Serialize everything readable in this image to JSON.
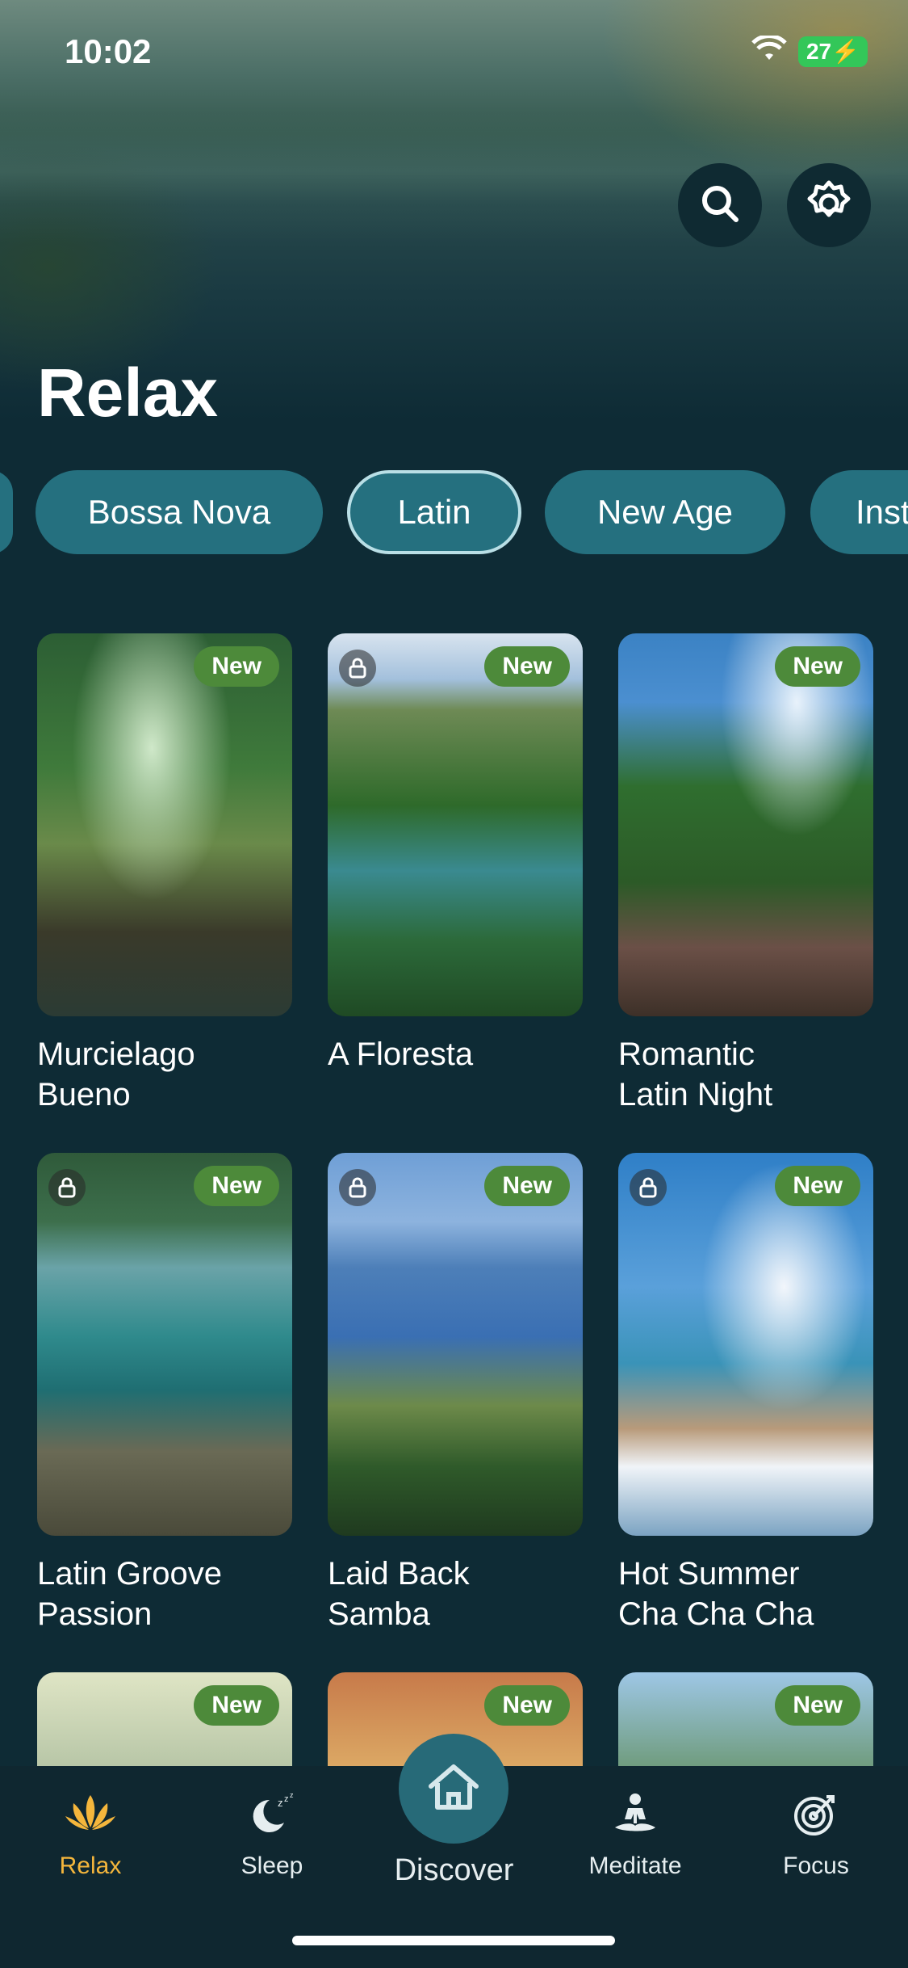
{
  "status": {
    "time": "10:02",
    "battery": "27"
  },
  "header": {
    "title": "Relax"
  },
  "categories": [
    {
      "label": "",
      "selected": false
    },
    {
      "label": "Bossa Nova",
      "selected": false
    },
    {
      "label": "Latin",
      "selected": true
    },
    {
      "label": "New Age",
      "selected": false
    },
    {
      "label": "Inst",
      "selected": false
    }
  ],
  "tracks": [
    {
      "title": "Murcielago\nBueno",
      "badge": "New",
      "locked": false
    },
    {
      "title": "A Floresta",
      "badge": "New",
      "locked": true
    },
    {
      "title": "Romantic\nLatin Night",
      "badge": "New",
      "locked": false
    },
    {
      "title": "Latin Groove\nPassion",
      "badge": "New",
      "locked": true
    },
    {
      "title": "Laid Back\nSamba",
      "badge": "New",
      "locked": true
    },
    {
      "title": "Hot Summer\nCha Cha Cha",
      "badge": "New",
      "locked": true
    },
    {
      "title": "",
      "badge": "New",
      "locked": false
    },
    {
      "title": "",
      "badge": "New",
      "locked": false
    },
    {
      "title": "",
      "badge": "New",
      "locked": false
    }
  ],
  "nav": {
    "relax": "Relax",
    "sleep": "Sleep",
    "discover": "Discover",
    "meditate": "Meditate",
    "focus": "Focus",
    "active": "relax"
  },
  "icons": [
    "wifi-icon",
    "battery-icon",
    "search-icon",
    "gear-icon",
    "lock-icon",
    "lotus-icon",
    "moon-icon",
    "home-icon",
    "meditate-icon",
    "target-icon"
  ],
  "colors": {
    "background": "#0e2b35",
    "chip": "#25707f",
    "badge": "#4d8a3a",
    "active": "#f4b63c"
  }
}
